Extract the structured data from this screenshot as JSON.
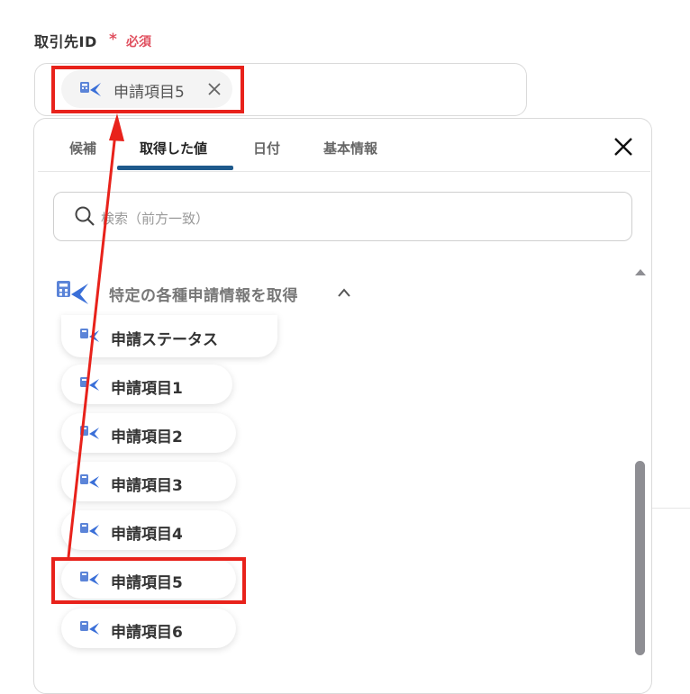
{
  "field": {
    "label": "取引先ID",
    "required_mark": "*",
    "required_text": "必須"
  },
  "selected": {
    "chip_label": "申請項目5",
    "remove_symbol": "×"
  },
  "tabs": [
    {
      "label": "候補"
    },
    {
      "label": "取得した値"
    },
    {
      "label": "日付"
    },
    {
      "label": "基本情報"
    }
  ],
  "search": {
    "placeholder": "検索（前方一致）"
  },
  "group": {
    "title": "特定の各種申請情報を取得",
    "state": "expanded"
  },
  "items": [
    {
      "label": "申請ステータス"
    },
    {
      "label": "申請項目1"
    },
    {
      "label": "申請項目2"
    },
    {
      "label": "申請項目3"
    },
    {
      "label": "申請項目4"
    },
    {
      "label": "申請項目5"
    },
    {
      "label": "申請項目6"
    }
  ],
  "colors": {
    "required": "#e0505f",
    "active_tab_underline": "#1e5a8c",
    "highlight_box": "#e8221b",
    "arrow": "#e8221b",
    "icon_blue": "#3a6fd8"
  },
  "icons": [
    "chip-app-icon",
    "remove-icon",
    "close-icon",
    "search-icon",
    "app-icon",
    "chevron-up-icon",
    "scroll-up-icon"
  ]
}
